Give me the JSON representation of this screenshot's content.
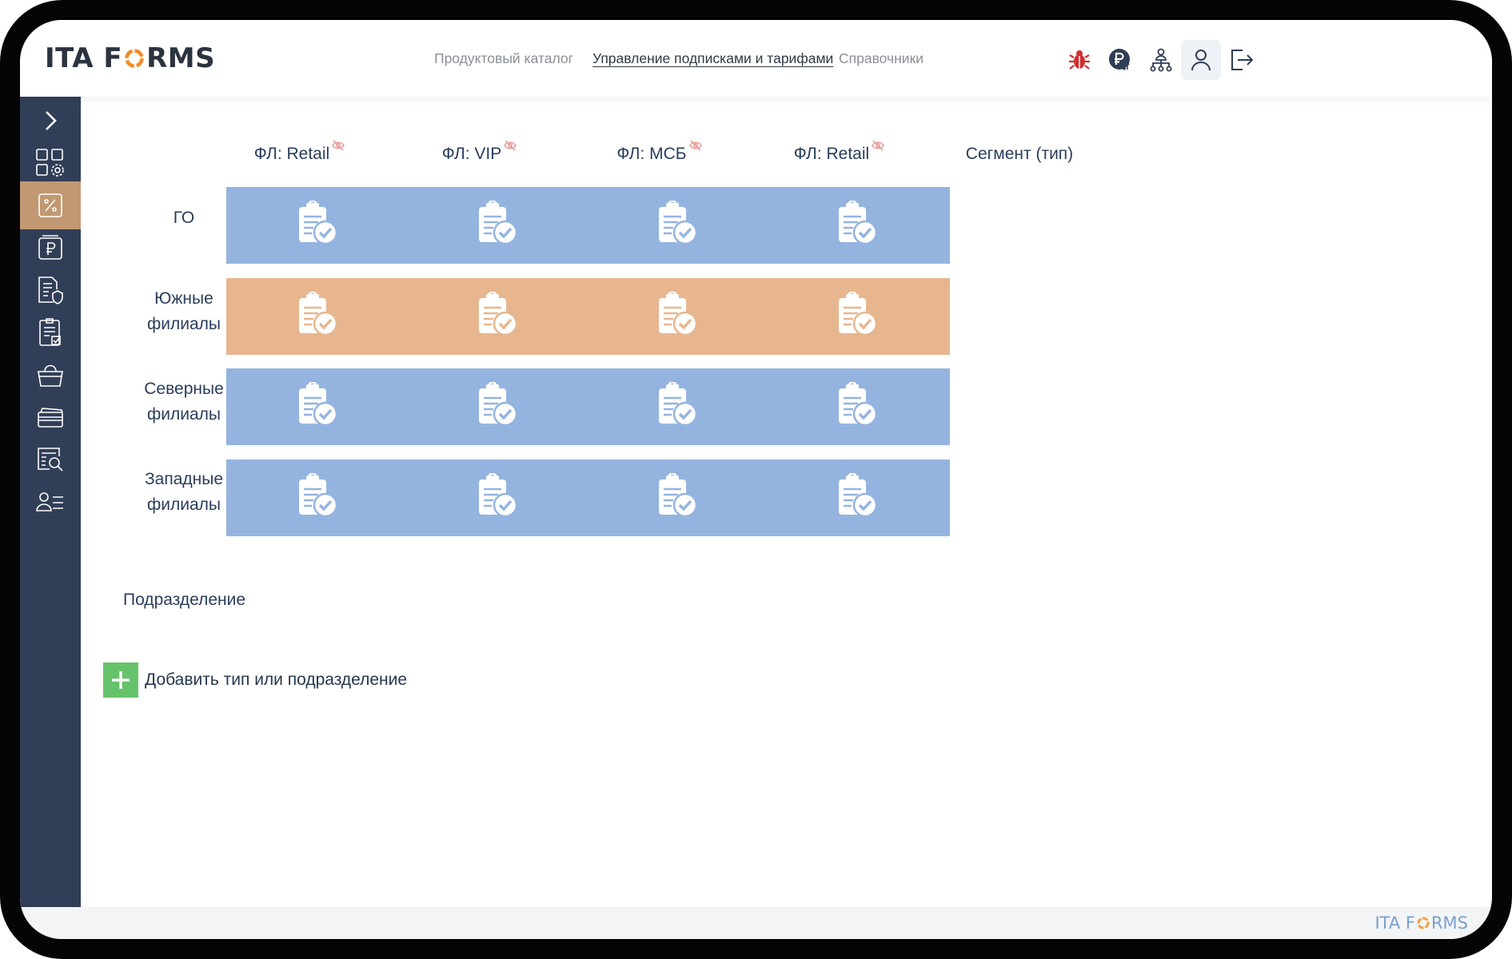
{
  "brand": {
    "logo_prefix": "ITA F",
    "logo_suffix": "RMS",
    "footer_prefix": "ITA F",
    "footer_suffix": "RMS"
  },
  "nav": {
    "items": [
      {
        "label": "Продуктовый каталог"
      },
      {
        "label": "Управление подписками и тарифами"
      },
      {
        "label": "Справочники"
      }
    ],
    "active_index": 1
  },
  "header_icons": [
    "bug-icon",
    "ruble-exchange-icon",
    "org-structure-icon",
    "user-icon",
    "logout-icon"
  ],
  "sidebar_icons": [
    "chevron-right-icon",
    "apps-settings-icon",
    "percent-icon",
    "ruble-icon",
    "document-shield-icon",
    "checklist-icon",
    "shopping-bag-icon",
    "cards-icon",
    "search-list-icon",
    "users-list-icon"
  ],
  "columns": [
    {
      "label": "ФЛ: Retail",
      "hidden_icon": true
    },
    {
      "label": "ФЛ: VIP",
      "hidden_icon": true
    },
    {
      "label": "ФЛ: МСБ",
      "hidden_icon": true
    },
    {
      "label": "ФЛ: Retail",
      "hidden_icon": true
    },
    {
      "label": "Сегмент (тип)",
      "hidden_icon": false
    }
  ],
  "rows": [
    {
      "label_line1": "ГО",
      "label_line2": "",
      "color": "blue"
    },
    {
      "label_line1": "Южные",
      "label_line2": "филиалы",
      "color": "orange"
    },
    {
      "label_line1": "Северные",
      "label_line2": "филиалы",
      "color": "blue"
    },
    {
      "label_line1": "Западные",
      "label_line2": "филиалы",
      "color": "blue"
    }
  ],
  "subdivision_label": "Подразделение",
  "add_label": "Добавить тип или подразделение",
  "colors": {
    "tile_blue": "#94b4df",
    "tile_orange": "#e8b68e",
    "sidebar": "#313e57",
    "sidebar_active": "#c29872",
    "add_green": "#67c36b",
    "eye_icon": "#e8a0a0"
  }
}
